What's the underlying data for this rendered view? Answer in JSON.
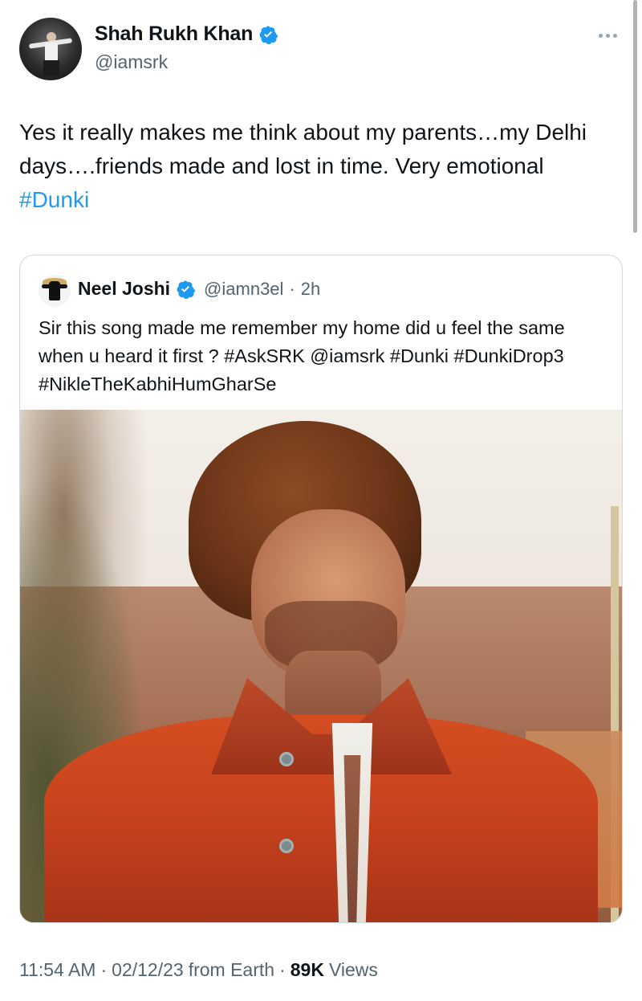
{
  "tweet": {
    "author": {
      "name": "Shah Rukh Khan",
      "handle": "@iamsrk"
    },
    "text_parts": [
      "Yes it really makes me think about my parents…my Delhi days….friends made and lost in time. Very emotional ",
      "#Dunki"
    ],
    "more_icon": "more-horizontal-icon",
    "verified_icon": "verified-badge-icon"
  },
  "quote": {
    "author": {
      "name": "Neel Joshi",
      "handle": "@iamn3el",
      "dot": "·",
      "time": "2h"
    },
    "text": "Sir this song made me remember my home did u feel the same when u heard it first ? #AskSRK @iamsrk #Dunki #DunkiDrop3 #NikleTheKabhiHumGharSe",
    "image_description": "quoted-image"
  },
  "meta": {
    "time": "11:54 AM",
    "separator1": "·",
    "date": "02/12/23",
    "source": "from Earth",
    "separator2": "·",
    "views_count": "89K",
    "views_label": "Views"
  },
  "colors": {
    "link": "#1d9bf0",
    "text": "#0f1419",
    "secondary": "#536471",
    "border": "#cfd9de"
  }
}
